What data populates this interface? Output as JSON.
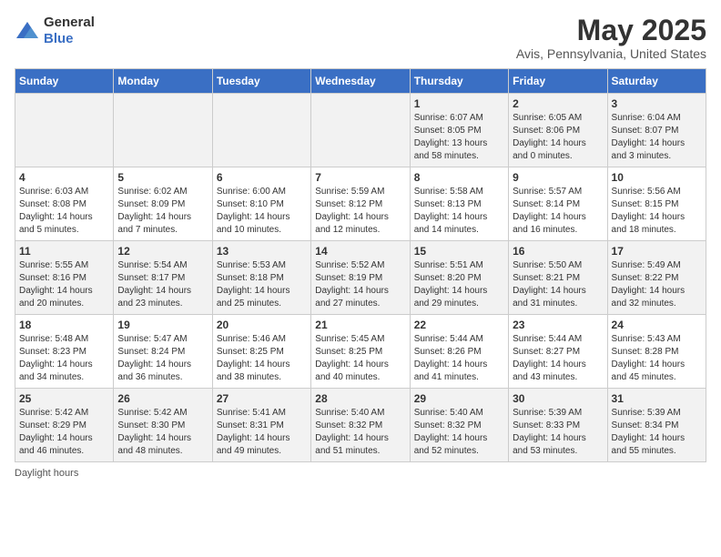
{
  "logo": {
    "general": "General",
    "blue": "Blue"
  },
  "header": {
    "title": "May 2025",
    "subtitle": "Avis, Pennsylvania, United States"
  },
  "days_of_week": [
    "Sunday",
    "Monday",
    "Tuesday",
    "Wednesday",
    "Thursday",
    "Friday",
    "Saturday"
  ],
  "weeks": [
    [
      {
        "day": "",
        "info": ""
      },
      {
        "day": "",
        "info": ""
      },
      {
        "day": "",
        "info": ""
      },
      {
        "day": "",
        "info": ""
      },
      {
        "day": "1",
        "info": "Sunrise: 6:07 AM\nSunset: 8:05 PM\nDaylight: 13 hours\nand 58 minutes."
      },
      {
        "day": "2",
        "info": "Sunrise: 6:05 AM\nSunset: 8:06 PM\nDaylight: 14 hours\nand 0 minutes."
      },
      {
        "day": "3",
        "info": "Sunrise: 6:04 AM\nSunset: 8:07 PM\nDaylight: 14 hours\nand 3 minutes."
      }
    ],
    [
      {
        "day": "4",
        "info": "Sunrise: 6:03 AM\nSunset: 8:08 PM\nDaylight: 14 hours\nand 5 minutes."
      },
      {
        "day": "5",
        "info": "Sunrise: 6:02 AM\nSunset: 8:09 PM\nDaylight: 14 hours\nand 7 minutes."
      },
      {
        "day": "6",
        "info": "Sunrise: 6:00 AM\nSunset: 8:10 PM\nDaylight: 14 hours\nand 10 minutes."
      },
      {
        "day": "7",
        "info": "Sunrise: 5:59 AM\nSunset: 8:12 PM\nDaylight: 14 hours\nand 12 minutes."
      },
      {
        "day": "8",
        "info": "Sunrise: 5:58 AM\nSunset: 8:13 PM\nDaylight: 14 hours\nand 14 minutes."
      },
      {
        "day": "9",
        "info": "Sunrise: 5:57 AM\nSunset: 8:14 PM\nDaylight: 14 hours\nand 16 minutes."
      },
      {
        "day": "10",
        "info": "Sunrise: 5:56 AM\nSunset: 8:15 PM\nDaylight: 14 hours\nand 18 minutes."
      }
    ],
    [
      {
        "day": "11",
        "info": "Sunrise: 5:55 AM\nSunset: 8:16 PM\nDaylight: 14 hours\nand 20 minutes."
      },
      {
        "day": "12",
        "info": "Sunrise: 5:54 AM\nSunset: 8:17 PM\nDaylight: 14 hours\nand 23 minutes."
      },
      {
        "day": "13",
        "info": "Sunrise: 5:53 AM\nSunset: 8:18 PM\nDaylight: 14 hours\nand 25 minutes."
      },
      {
        "day": "14",
        "info": "Sunrise: 5:52 AM\nSunset: 8:19 PM\nDaylight: 14 hours\nand 27 minutes."
      },
      {
        "day": "15",
        "info": "Sunrise: 5:51 AM\nSunset: 8:20 PM\nDaylight: 14 hours\nand 29 minutes."
      },
      {
        "day": "16",
        "info": "Sunrise: 5:50 AM\nSunset: 8:21 PM\nDaylight: 14 hours\nand 31 minutes."
      },
      {
        "day": "17",
        "info": "Sunrise: 5:49 AM\nSunset: 8:22 PM\nDaylight: 14 hours\nand 32 minutes."
      }
    ],
    [
      {
        "day": "18",
        "info": "Sunrise: 5:48 AM\nSunset: 8:23 PM\nDaylight: 14 hours\nand 34 minutes."
      },
      {
        "day": "19",
        "info": "Sunrise: 5:47 AM\nSunset: 8:24 PM\nDaylight: 14 hours\nand 36 minutes."
      },
      {
        "day": "20",
        "info": "Sunrise: 5:46 AM\nSunset: 8:25 PM\nDaylight: 14 hours\nand 38 minutes."
      },
      {
        "day": "21",
        "info": "Sunrise: 5:45 AM\nSunset: 8:25 PM\nDaylight: 14 hours\nand 40 minutes."
      },
      {
        "day": "22",
        "info": "Sunrise: 5:44 AM\nSunset: 8:26 PM\nDaylight: 14 hours\nand 41 minutes."
      },
      {
        "day": "23",
        "info": "Sunrise: 5:44 AM\nSunset: 8:27 PM\nDaylight: 14 hours\nand 43 minutes."
      },
      {
        "day": "24",
        "info": "Sunrise: 5:43 AM\nSunset: 8:28 PM\nDaylight: 14 hours\nand 45 minutes."
      }
    ],
    [
      {
        "day": "25",
        "info": "Sunrise: 5:42 AM\nSunset: 8:29 PM\nDaylight: 14 hours\nand 46 minutes."
      },
      {
        "day": "26",
        "info": "Sunrise: 5:42 AM\nSunset: 8:30 PM\nDaylight: 14 hours\nand 48 minutes."
      },
      {
        "day": "27",
        "info": "Sunrise: 5:41 AM\nSunset: 8:31 PM\nDaylight: 14 hours\nand 49 minutes."
      },
      {
        "day": "28",
        "info": "Sunrise: 5:40 AM\nSunset: 8:32 PM\nDaylight: 14 hours\nand 51 minutes."
      },
      {
        "day": "29",
        "info": "Sunrise: 5:40 AM\nSunset: 8:32 PM\nDaylight: 14 hours\nand 52 minutes."
      },
      {
        "day": "30",
        "info": "Sunrise: 5:39 AM\nSunset: 8:33 PM\nDaylight: 14 hours\nand 53 minutes."
      },
      {
        "day": "31",
        "info": "Sunrise: 5:39 AM\nSunset: 8:34 PM\nDaylight: 14 hours\nand 55 minutes."
      }
    ]
  ],
  "footer": {
    "daylight_label": "Daylight hours"
  }
}
